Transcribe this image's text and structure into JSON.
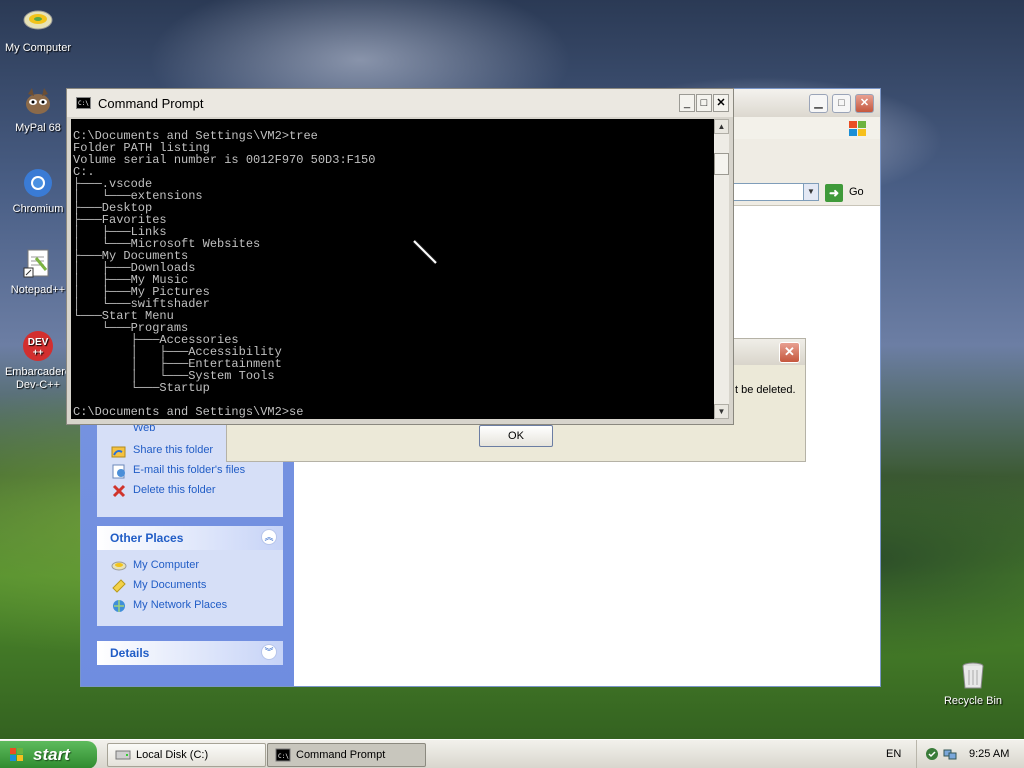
{
  "desktop": {
    "icons": [
      {
        "label": "My Computer",
        "icon": "my-computer-icon"
      },
      {
        "label": "MyPal 68",
        "icon": "mypal-icon"
      },
      {
        "label": "Chromium",
        "icon": "chromium-icon"
      },
      {
        "label": "Notepad++",
        "icon": "notepad-plus-plus-icon"
      },
      {
        "label_line1": "Embarcadero",
        "label_line2": "Dev-C++",
        "icon": "dev-cpp-icon"
      },
      {
        "label": "Recycle Bin",
        "icon": "recycle-bin-icon"
      }
    ]
  },
  "explorer": {
    "address_go_label": "Go",
    "file_tasks": [
      {
        "label": "Web",
        "icon": "publish-web-icon"
      },
      {
        "label": "Share this folder",
        "icon": "share-folder-icon"
      },
      {
        "label": "E-mail this folder's files",
        "icon": "email-icon"
      },
      {
        "label": "Delete this folder",
        "icon": "delete-icon"
      }
    ],
    "other_places": {
      "title": "Other Places",
      "items": [
        {
          "label": "My Computer",
          "icon": "my-computer-icon"
        },
        {
          "label": "My Documents",
          "icon": "my-documents-icon"
        },
        {
          "label": "My Network Places",
          "icon": "network-places-icon"
        }
      ]
    },
    "details": {
      "title": "Details"
    }
  },
  "dialog": {
    "message_visible": "t be deleted.",
    "ok_label": "OK"
  },
  "cmd": {
    "title": "Command Prompt",
    "icon_text": "C:\\",
    "lines": [
      "C:\\Documents and Settings\\VM2>tree",
      "Folder PATH listing",
      "Volume serial number is 0012F970 50D3:F150",
      "C:.",
      "├───.vscode",
      "│   └───extensions",
      "├───Desktop",
      "├───Favorites",
      "│   ├───Links",
      "│   └───Microsoft Websites",
      "├───My Documents",
      "│   ├───Downloads",
      "│   ├───My Music",
      "│   ├───My Pictures",
      "│   └───swiftshader",
      "└───Start Menu",
      "    └───Programs",
      "        ├───Accessories",
      "        │   ├───Accessibility",
      "        │   ├───Entertainment",
      "        │   └───System Tools",
      "        └───Startup",
      "",
      "C:\\Documents and Settings\\VM2>se"
    ]
  },
  "taskbar": {
    "start_label": "start",
    "buttons": [
      {
        "label": "Local Disk (C:)",
        "icon": "drive-icon"
      },
      {
        "label": "Command Prompt",
        "icon": "cmd-icon"
      }
    ],
    "language": "EN",
    "time": "9:25 AM"
  }
}
